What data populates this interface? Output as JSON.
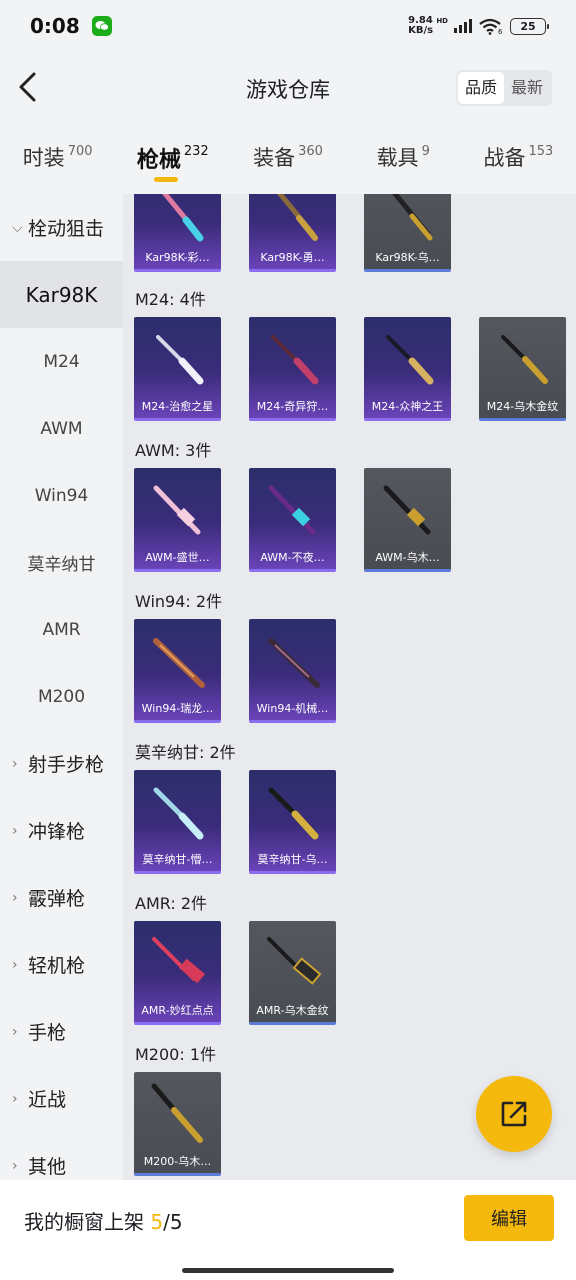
{
  "status": {
    "time": "0:08",
    "net_speed_top": "9.84",
    "net_speed_bottom": "KB/s",
    "net_tag": "HD",
    "battery": "25"
  },
  "header": {
    "title": "游戏仓库",
    "sort_quality": "品质",
    "sort_newest": "最新"
  },
  "tabs": [
    {
      "label": "时装",
      "count": "700"
    },
    {
      "label": "枪械",
      "count": "232"
    },
    {
      "label": "装备",
      "count": "360"
    },
    {
      "label": "载具",
      "count": "9"
    },
    {
      "label": "战备",
      "count": "153"
    }
  ],
  "sidebar": {
    "bolt": "栓动狙击",
    "kar98k": "Kar98K",
    "m24": "M24",
    "awm": "AWM",
    "win94": "Win94",
    "mosin": "莫辛纳甘",
    "amr": "AMR",
    "m200": "M200",
    "dmr": "射手步枪",
    "smg": "冲锋枪",
    "shotgun": "霰弹枪",
    "lmg": "轻机枪",
    "pistol": "手枪",
    "melee": "近战",
    "other": "其他"
  },
  "groups": {
    "kar98k": {
      "items": [
        "Kar98K-彩…",
        "Kar98K-勇…",
        "Kar98K-乌…"
      ]
    },
    "m24": {
      "title": "M24: 4件",
      "items": [
        "M24-治愈之星",
        "M24-奇异狩…",
        "M24-众神之王",
        "M24-乌木金纹"
      ]
    },
    "awm": {
      "title": "AWM: 3件",
      "items": [
        "AWM-盛世…",
        "AWM-不夜…",
        "AWM-乌木…"
      ]
    },
    "win94": {
      "title": "Win94: 2件",
      "items": [
        "Win94-瑞龙…",
        "Win94-机械…"
      ]
    },
    "mosin": {
      "title": "莫辛纳甘: 2件",
      "items": [
        "莫辛纳甘-懵…",
        "莫辛纳甘-乌…"
      ]
    },
    "amr": {
      "title": "AMR: 2件",
      "items": [
        "AMR-妙红点点",
        "AMR-乌木金纹"
      ]
    },
    "m200": {
      "title": "M200: 1件",
      "items": [
        "M200-乌木…"
      ]
    }
  },
  "bottom": {
    "showcase_label": "我的橱窗上架",
    "showcase_current": "5",
    "showcase_total": "/5",
    "edit_label": "编辑"
  },
  "colors": {
    "accent": "#f5b80c",
    "card_purple": "#3a2c7a",
    "card_gray": "#4a4c53"
  }
}
